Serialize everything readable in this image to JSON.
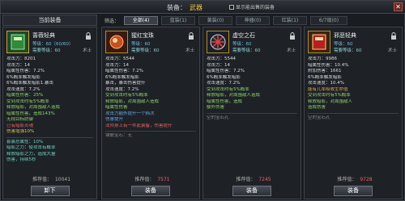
{
  "title": {
    "main": "装备：",
    "sub": "武器"
  },
  "option_label": "显示能出售的装备",
  "close": "✕",
  "filter": {
    "label": "筛选：",
    "tabs": [
      {
        "label": "全部(4)",
        "active": true
      },
      {
        "label": "蓝装(1)",
        "active": false
      },
      {
        "label": "黄装(0)",
        "active": false
      },
      {
        "label": "神器(0)",
        "active": false
      },
      {
        "label": "红装(1)",
        "active": false
      },
      {
        "label": "6/7级(0)",
        "active": false
      }
    ]
  },
  "current": {
    "header": "当前装备",
    "name": "蔷薇轻典",
    "level": "等级：60（60/60）",
    "req": "需要等级：60",
    "role": "术士",
    "stats": [
      {
        "text": "攻击力：8201",
        "cls": "w"
      },
      {
        "text": "攻击力：14",
        "cls": "w"
      },
      {
        "text": "暗属性伤害：7.2%",
        "cls": "w"
      },
      {
        "text": "6%概率触发暗影",
        "cls": "w"
      },
      {
        "text": "6%概率触发暗影1.暴击",
        "cls": "w"
      },
      {
        "text": "攻击速度：7.2%",
        "cls": "w"
      },
      {
        "text": "暗属性伤害：25%",
        "cls": "g"
      },
      {
        "text": "受到攻击时有5%概率",
        "cls": "g"
      },
      {
        "text": "释放暗影，对周围敌人造成",
        "cls": "g"
      },
      {
        "text": "暗属性伤害，造成143%",
        "cls": "g"
      },
      {
        "text": "无视目标防御",
        "cls": "g"
      }
    ],
    "red_line": "已有暗影灵魂",
    "set_label": "伤害增强10%",
    "set_lines": [
      "套装总属性：10%",
      "暗影之力：使攻击有概率",
      "释放暗影之力，造成大量",
      "伤害，持续5秒"
    ],
    "score_label": "推荐值：",
    "score": "10041",
    "button": "卸下"
  },
  "cards": [
    {
      "name": "猩红宝珠",
      "level": "等级：60",
      "req": "需要等级：60",
      "role": "术士",
      "stats": [
        {
          "text": "攻击力：5544",
          "cls": "w"
        },
        {
          "text": "攻击力：14",
          "cls": "w"
        },
        {
          "text": "暗属性伤害：7.2%",
          "cls": "w"
        },
        {
          "text": "6%概率触发暗影",
          "cls": "w"
        },
        {
          "text": "暴击，暴击伤害提升",
          "cls": "w"
        },
        {
          "text": "攻击速度：7.2%",
          "cls": "w"
        },
        {
          "text": "受到攻击时有5%概率",
          "cls": "g"
        },
        {
          "text": "释放暗影，对周围敌人造成",
          "cls": "g"
        },
        {
          "text": "暗属性伤害",
          "cls": "g"
        },
        {
          "text": "攻击力额外提升一个档次",
          "cls": "b"
        },
        {
          "text": "伤害提升",
          "cls": "b"
        }
      ],
      "red_line": "法师身上有一件此装备，伤害提升",
      "gem_line": "镶嵌宝石：无",
      "score_label": "推荐值：",
      "score": "7571",
      "button": "装备"
    },
    {
      "name": "虚空之石",
      "level": "等级：60",
      "req": "需要等级：60",
      "role": "术士",
      "stats": [
        {
          "text": "攻击力：5544",
          "cls": "w"
        },
        {
          "text": "攻击力：14",
          "cls": "w"
        },
        {
          "text": "暗属性伤害：7.2%",
          "cls": "w"
        },
        {
          "text": "6%概率触发暗影",
          "cls": "w"
        },
        {
          "text": "攻击速度：7.2%",
          "cls": "w"
        },
        {
          "text": "受到攻击时有5%概率",
          "cls": "g"
        },
        {
          "text": "释放暗影，对周围敌人造成",
          "cls": "g"
        },
        {
          "text": "暗属性伤害，造成",
          "cls": "g"
        },
        {
          "text": "额外伤害",
          "cls": "g"
        }
      ],
      "gem_line": "空的宝石孔",
      "score_label": "推荐值：",
      "score": "7245",
      "button": "装备"
    },
    {
      "name": "邪恶轻典",
      "level": "等级：60",
      "req": "需要等级：60",
      "role": "术士",
      "stats": [
        {
          "text": "攻击力：9986",
          "cls": "w"
        },
        {
          "text": "暗属性伤害：10.4%",
          "cls": "w"
        },
        {
          "text": "附加伤害：1661",
          "cls": "w"
        },
        {
          "text": "6%概率触发暗影",
          "cls": "w"
        },
        {
          "text": "攻击速度：10.4%",
          "cls": "w"
        },
        {
          "text": "能有几率吸收生命值",
          "cls": "o"
        },
        {
          "text": "受到攻击时有5%概率",
          "cls": "g"
        },
        {
          "text": "释放暗影，对周围敌人",
          "cls": "g"
        },
        {
          "text": "造成伤害",
          "cls": "g"
        }
      ],
      "gem_line": "空的宝石孔",
      "score_label": "推荐值：",
      "score": "9728",
      "button": "装备"
    }
  ]
}
